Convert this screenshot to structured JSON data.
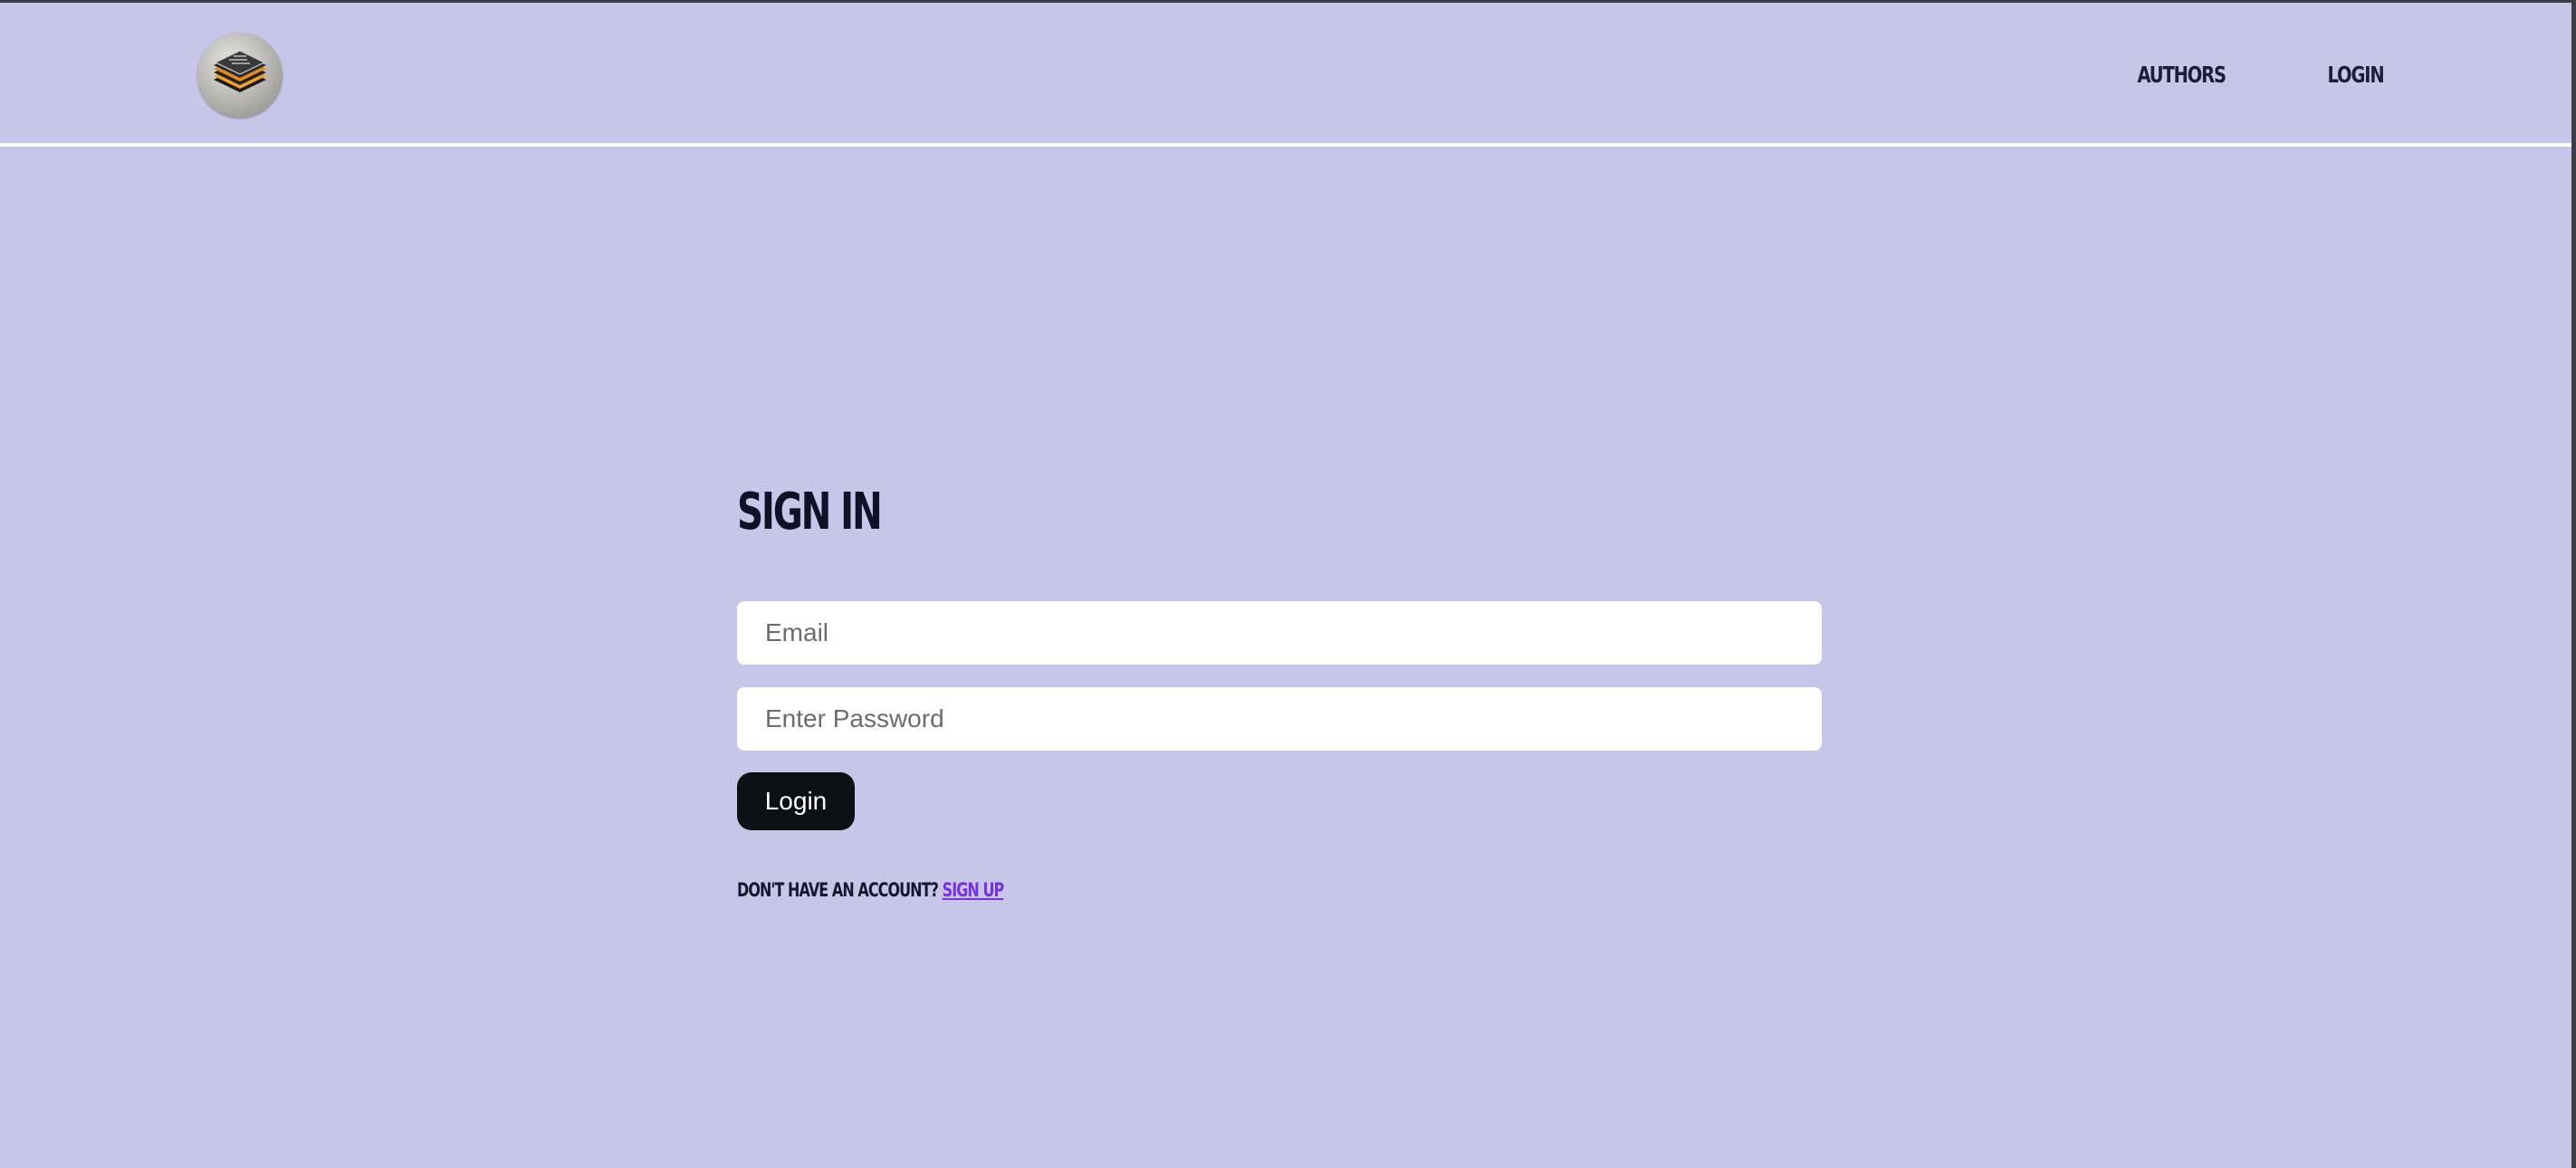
{
  "colors": {
    "background": "#c6c6e9",
    "nav_text": "#1d1d3a",
    "button_bg": "#0c1116",
    "button_text": "#ffffff",
    "link": "#7a2fe0",
    "divider": "#ffffff"
  },
  "header": {
    "logo_icon": "stacked-layers-logo-icon",
    "nav": [
      {
        "label": "AUTHORS"
      },
      {
        "label": "LOGIN"
      }
    ]
  },
  "main": {
    "title": "SIGN IN",
    "email": {
      "placeholder": "Email",
      "value": ""
    },
    "password": {
      "placeholder": "Enter Password",
      "value": ""
    },
    "login_button": "Login",
    "signup_prompt": "DON'T HAVE AN ACCOUNT?",
    "signup_link": "SIGN UP"
  }
}
